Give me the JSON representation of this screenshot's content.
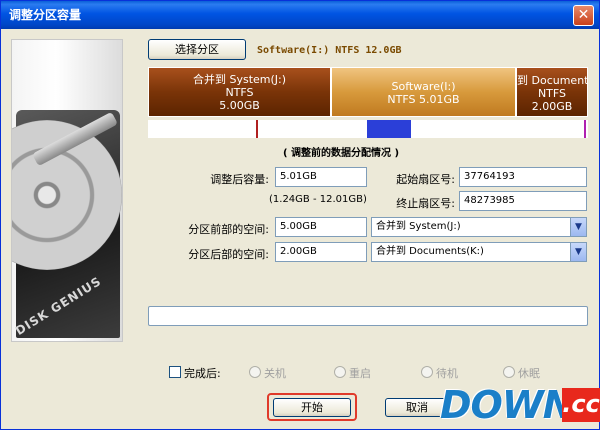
{
  "window": {
    "title": "调整分区容量",
    "close_glyph": "✕"
  },
  "brand": {
    "label": "DISK GENIUS"
  },
  "select_partition": {
    "button_label": "选择分区",
    "info": "Software(I:) NTFS 12.0GB"
  },
  "partitions": [
    {
      "name": "合并到 System(J:)",
      "fs": "NTFS",
      "size": "5.00GB"
    },
    {
      "name": "Software(I:)",
      "fs": "NTFS",
      "size": "5.01GB"
    },
    {
      "name": "到 Documents(K:)",
      "fs": "NTFS",
      "size": "2.00GB"
    }
  ],
  "section_title": "( 调整前的数据分配情况 )",
  "form": {
    "new_size_label": "调整后容量:",
    "new_size_value": "5.01GB",
    "range_hint": "(1.24GB - 12.01GB)",
    "start_sector_label": "起始扇区号:",
    "start_sector_value": "37764193",
    "end_sector_label": "终止扇区号:",
    "end_sector_value": "48273985",
    "before_space_label": "分区前部的空间:",
    "before_space_value": "5.00GB",
    "before_space_action": "合并到 System(J:)",
    "after_space_label": "分区后部的空间:",
    "after_space_value": "2.00GB",
    "after_space_action": "合并到 Documents(K:)"
  },
  "completion": {
    "label": "完成后:",
    "options": [
      "关机",
      "重启",
      "待机",
      "休眠"
    ]
  },
  "buttons": {
    "start": "开始",
    "cancel": "取消"
  },
  "watermark": {
    "main": "DOWN",
    "suffix": ".cc"
  },
  "colors": {
    "titlebar": "#0054e3",
    "partition_dark": "#7a3408",
    "partition_selected": "#d89a3c",
    "map_selection": "#2b3fd8",
    "highlight_ring": "#e03a2a"
  }
}
